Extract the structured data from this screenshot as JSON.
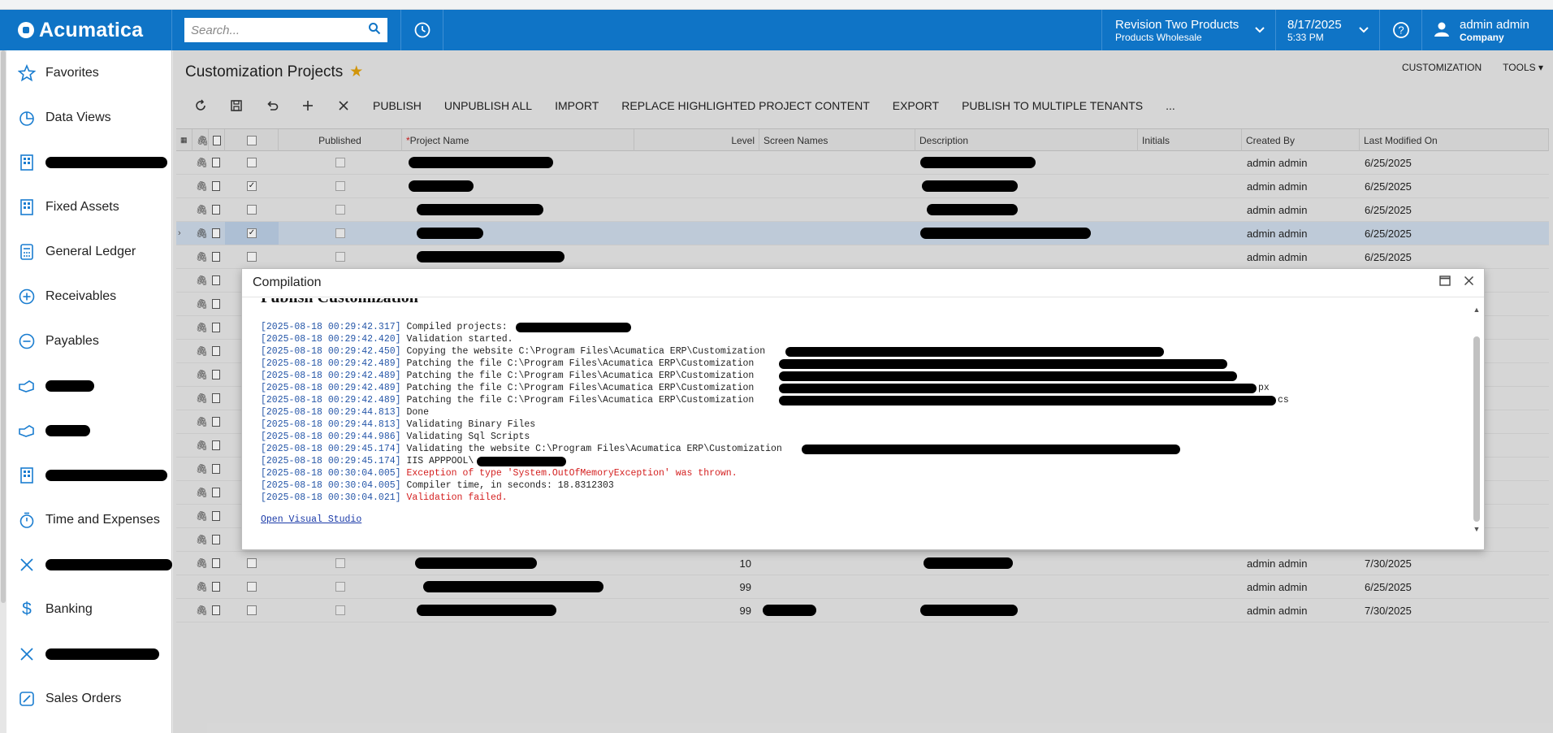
{
  "topbar": {
    "brand": "Acumatica",
    "search_placeholder": "Search...",
    "tenant_name": "Revision Two Products",
    "tenant_branch": "Products Wholesale",
    "date": "8/17/2025",
    "time": "5:33 PM",
    "user_name": "admin admin",
    "user_company": "Company"
  },
  "sidebar": {
    "items": [
      {
        "label": "Favorites",
        "icon": "star-icon"
      },
      {
        "label": "Data Views",
        "icon": "pie-chart-icon"
      },
      {
        "label": "",
        "icon": "building-icon"
      },
      {
        "label": "Fixed Assets",
        "icon": "building-icon"
      },
      {
        "label": "General Ledger",
        "icon": "calculator-icon"
      },
      {
        "label": "Receivables",
        "icon": "plus-circle-icon"
      },
      {
        "label": "Payables",
        "icon": "minus-circle-icon"
      },
      {
        "label": "",
        "icon": "hand-icon"
      },
      {
        "label": "",
        "icon": "hand-icon"
      },
      {
        "label": "",
        "icon": "building-icon"
      },
      {
        "label": "Time and Expenses",
        "icon": "stopwatch-icon"
      },
      {
        "label": "",
        "icon": "tools-icon"
      },
      {
        "label": "Banking",
        "icon": "dollar-icon"
      },
      {
        "label": "",
        "icon": "tools-icon"
      },
      {
        "label": "Sales Orders",
        "icon": "pencil-icon"
      }
    ]
  },
  "page": {
    "title": "Customization Projects",
    "links": [
      "CUSTOMIZATION",
      "TOOLS"
    ]
  },
  "toolbar": {
    "buttons": [
      "PUBLISH",
      "UNPUBLISH ALL",
      "IMPORT",
      "REPLACE HIGHLIGHTED PROJECT CONTENT",
      "EXPORT",
      "PUBLISH TO MULTIPLE TENANTS",
      "..."
    ]
  },
  "grid": {
    "columns": [
      "Published",
      "Project Name",
      "Level",
      "Screen Names",
      "Description",
      "Initials",
      "Created By",
      "Last Modified On"
    ],
    "rows": [
      {
        "checked": false,
        "level": "",
        "created_by": "admin admin",
        "modified": "6/25/2025"
      },
      {
        "checked": true,
        "level": "",
        "created_by": "admin admin",
        "modified": "6/25/2025"
      },
      {
        "checked": false,
        "level": "",
        "created_by": "admin admin",
        "modified": "6/25/2025"
      },
      {
        "checked": true,
        "level": "",
        "created_by": "admin admin",
        "modified": "6/25/2025",
        "selected": true
      },
      {
        "checked": false,
        "level": "",
        "created_by": "admin admin",
        "modified": "6/25/2025"
      },
      {
        "checked": false,
        "level": "",
        "created_by": "",
        "modified": ""
      },
      {
        "checked": false,
        "level": "",
        "created_by": "",
        "modified": ""
      },
      {
        "checked": false,
        "level": "",
        "created_by": "",
        "modified": ""
      },
      {
        "checked": false,
        "level": "",
        "created_by": "",
        "modified": ""
      },
      {
        "checked": false,
        "level": "",
        "created_by": "",
        "modified": ""
      },
      {
        "checked": false,
        "level": "",
        "created_by": "",
        "modified": ""
      },
      {
        "checked": false,
        "level": "",
        "created_by": "",
        "modified": ""
      },
      {
        "checked": false,
        "level": "",
        "created_by": "",
        "modified": ""
      },
      {
        "checked": false,
        "level": "",
        "created_by": "",
        "modified": ""
      },
      {
        "checked": false,
        "level": "",
        "created_by": "",
        "modified": ""
      },
      {
        "checked": false,
        "level": "",
        "created_by": "",
        "modified": ""
      },
      {
        "checked": false,
        "level": "",
        "created_by": "",
        "modified": ""
      },
      {
        "checked": false,
        "level": "10",
        "created_by": "admin admin",
        "modified": "7/30/2025"
      },
      {
        "checked": false,
        "level": "99",
        "created_by": "admin admin",
        "modified": "6/25/2025"
      },
      {
        "checked": false,
        "level": "99",
        "created_by": "admin admin",
        "modified": "7/30/2025"
      }
    ]
  },
  "dialog": {
    "title": "Compilation",
    "heading": "Publish Customization",
    "log": [
      {
        "ts": "[2025-08-18 00:29:42.317]",
        "msg": "Compiled projects:",
        "kind": "normal"
      },
      {
        "ts": "[2025-08-18 00:29:42.420]",
        "msg": "Validation started.",
        "kind": "normal"
      },
      {
        "ts": "[2025-08-18 00:29:42.450]",
        "msg": "Copying the website C:\\Program Files\\Acumatica ERP\\Customization",
        "kind": "normal"
      },
      {
        "ts": "[2025-08-18 00:29:42.489]",
        "msg": "Patching the file C:\\Program Files\\Acumatica ERP\\Customization",
        "kind": "normal"
      },
      {
        "ts": "[2025-08-18 00:29:42.489]",
        "msg": "Patching the file C:\\Program Files\\Acumatica ERP\\Customization",
        "kind": "normal"
      },
      {
        "ts": "[2025-08-18 00:29:42.489]",
        "msg": "Patching the file C:\\Program Files\\Acumatica ERP\\Customization",
        "kind": "normal",
        "tail": "px"
      },
      {
        "ts": "[2025-08-18 00:29:42.489]",
        "msg": "Patching the file C:\\Program Files\\Acumatica ERP\\Customization",
        "kind": "normal",
        "tail": "cs"
      },
      {
        "ts": "[2025-08-18 00:29:44.813]",
        "msg": "Done",
        "kind": "normal"
      },
      {
        "ts": "[2025-08-18 00:29:44.813]",
        "msg": "Validating Binary Files",
        "kind": "normal"
      },
      {
        "ts": "[2025-08-18 00:29:44.986]",
        "msg": "Validating Sql Scripts",
        "kind": "normal"
      },
      {
        "ts": "[2025-08-18 00:29:45.174]",
        "msg": "Validating the website C:\\Program Files\\Acumatica ERP\\Customization",
        "kind": "normal"
      },
      {
        "ts": "[2025-08-18 00:29:45.174]",
        "msg": "IIS APPPOOL\\",
        "kind": "normal"
      },
      {
        "ts": "[2025-08-18 00:30:04.005]",
        "msg": "Exception of type 'System.OutOfMemoryException' was thrown.",
        "kind": "error"
      },
      {
        "ts": "[2025-08-18 00:30:04.005]",
        "msg": "Compiler time, in seconds: 18.8312303",
        "kind": "normal"
      },
      {
        "ts": "[2025-08-18 00:30:04.021]",
        "msg": "Validation failed.",
        "kind": "error"
      }
    ],
    "link": "Open Visual Studio"
  }
}
